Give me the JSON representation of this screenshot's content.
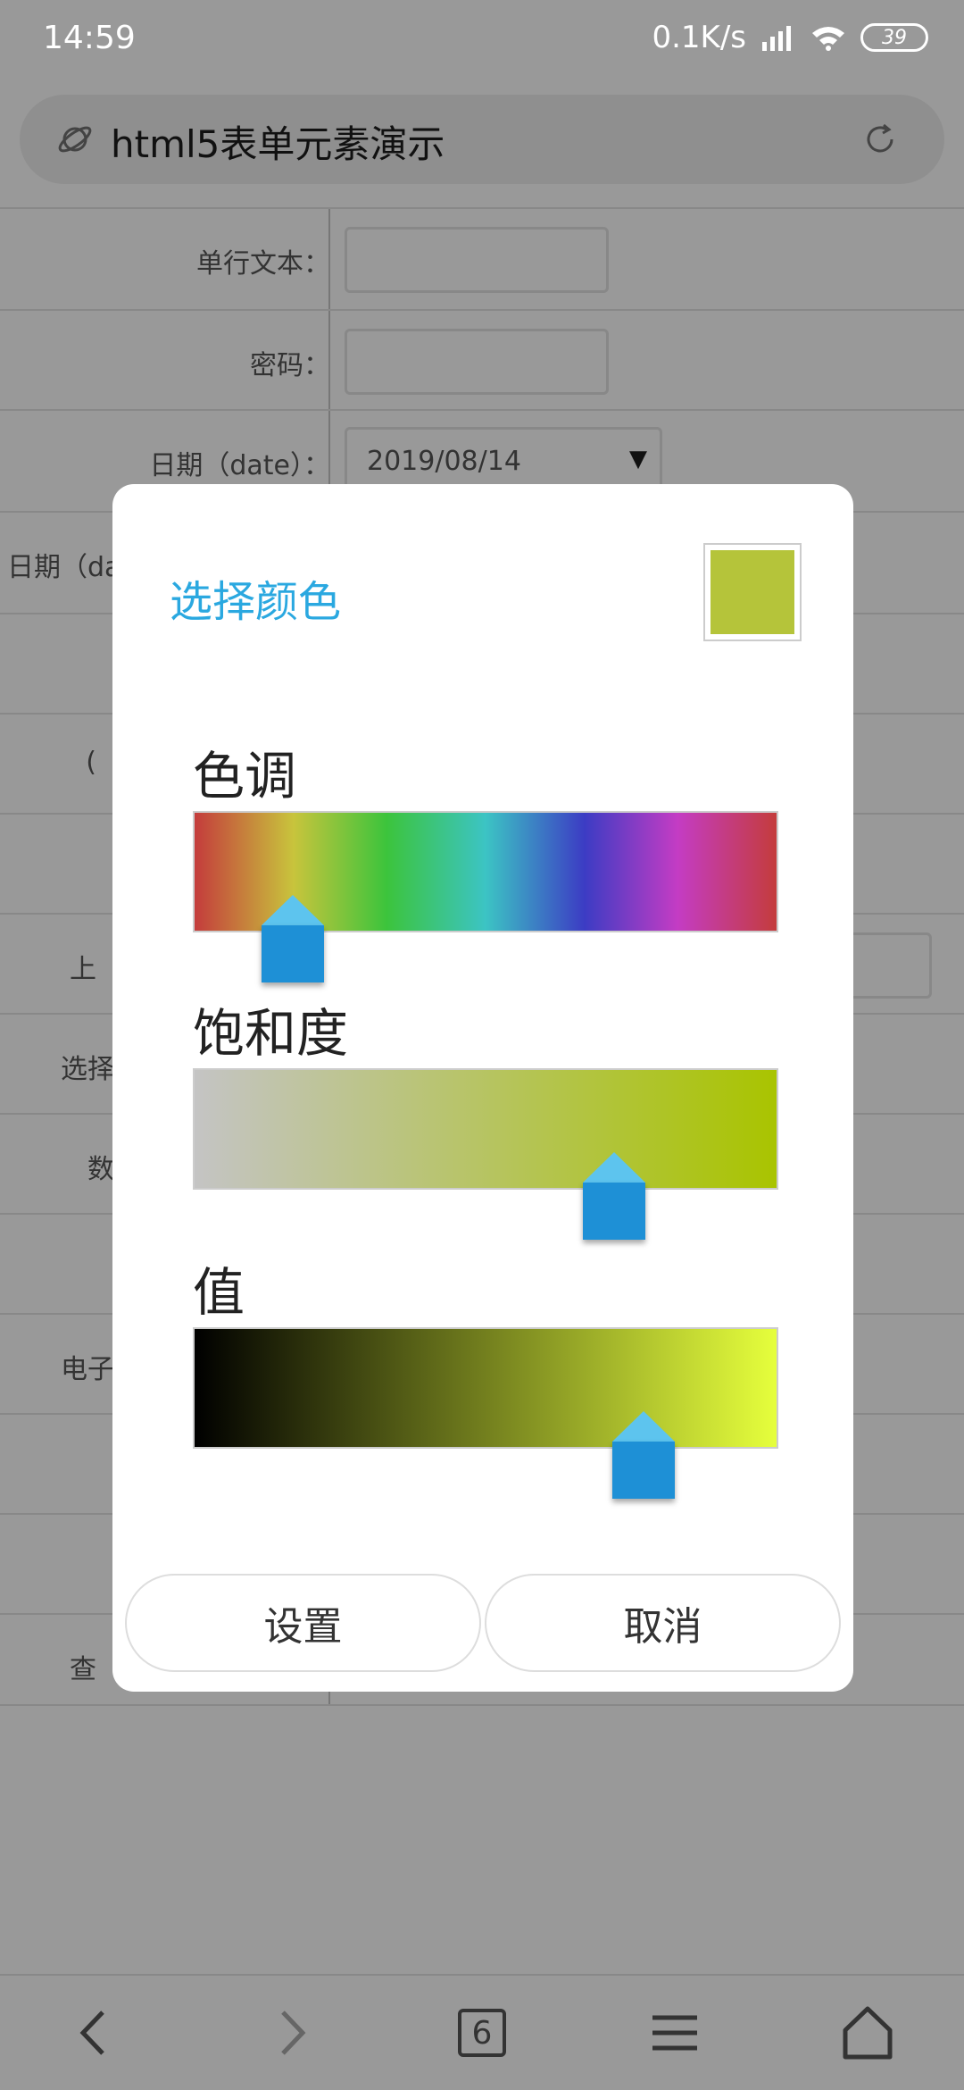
{
  "status_bar": {
    "time": "14:59",
    "speed": "0.1K/s",
    "battery": "39"
  },
  "address_bar": {
    "title": "html5表单元素演示"
  },
  "form": {
    "rows": [
      {
        "label": "单行文本："
      },
      {
        "label": "密码："
      },
      {
        "label": "日期（date）：",
        "value": "2019/08/14"
      },
      {
        "label": "日期（da"
      },
      {
        "label": ""
      },
      {
        "label": "("
      },
      {
        "label": ""
      },
      {
        "label": "上"
      },
      {
        "label": "选择"
      },
      {
        "label": "数"
      },
      {
        "label": ""
      },
      {
        "label": "电子"
      },
      {
        "label": ""
      },
      {
        "label": ""
      },
      {
        "label": "查"
      }
    ]
  },
  "dialog": {
    "title": "选择颜色",
    "selected_color": "#b5c43a",
    "hue": {
      "label": "色调",
      "level": 0.17
    },
    "saturation": {
      "label": "饱和度",
      "level": 0.72
    },
    "value": {
      "label": "值",
      "level": 0.77
    },
    "set_button": "设置",
    "cancel_button": "取消"
  },
  "nav": {
    "tab_count": "6"
  }
}
